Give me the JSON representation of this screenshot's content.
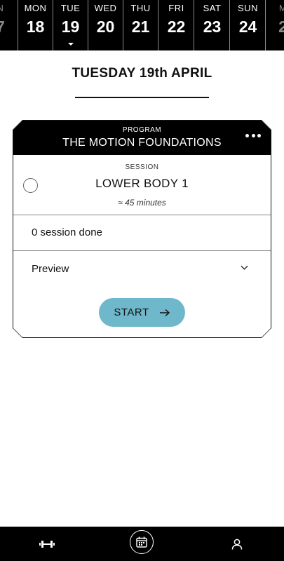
{
  "week": {
    "days": [
      {
        "name": "N",
        "num": "7"
      },
      {
        "name": "MON",
        "num": "18"
      },
      {
        "name": "TUE",
        "num": "19"
      },
      {
        "name": "WED",
        "num": "20"
      },
      {
        "name": "THU",
        "num": "21"
      },
      {
        "name": "FRI",
        "num": "22"
      },
      {
        "name": "SAT",
        "num": "23"
      },
      {
        "name": "SUN",
        "num": "24"
      },
      {
        "name": "M",
        "num": "2"
      }
    ],
    "selected_index": 2
  },
  "date_heading": "TUESDAY 19th APRIL",
  "card": {
    "program_kicker": "PROGRAM",
    "program_title": "THE MOTION FOUNDATIONS",
    "more_icon": "more-horizontal-icon",
    "session_kicker": "SESSION",
    "session_name": "LOWER BODY 1",
    "session_duration": "≈ 45 minutes",
    "sessions_done": "0 session done",
    "preview_label": "Preview",
    "start_label": "START"
  },
  "bottom_nav": {
    "items": [
      "dumbbell-icon",
      "calendar-icon",
      "user-icon"
    ],
    "active": "calendar-icon"
  },
  "colors": {
    "accent": "#6fb8cb",
    "header_bg": "#000000"
  }
}
